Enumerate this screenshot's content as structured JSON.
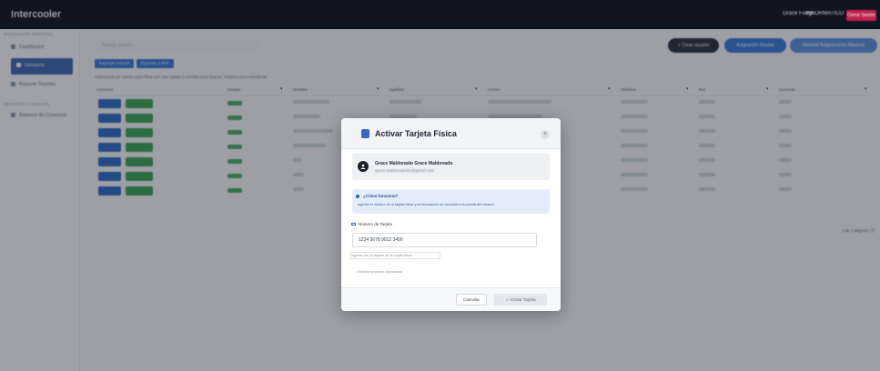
{
  "app": {
    "brand": "Intercooler",
    "top_user": "Grace Fuego",
    "top_role": "INFORMATICO",
    "logout_label": "Cerrar Sesión"
  },
  "sidebar": {
    "section_main": "NAVEGACIÓN PRINCIPAL",
    "section_reports": "REPORTES Y ANÁLISIS",
    "items": [
      {
        "label": "Dashboard"
      },
      {
        "label": "Usuarios"
      },
      {
        "label": "Reporte Tarjetas"
      },
      {
        "label": "Balance de Consumo"
      }
    ]
  },
  "main": {
    "search_placeholder": "Buscar usuario...",
    "actions": {
      "create_user": "+ Crear usuario",
      "mass_assign": "Asignación Masiva",
      "batch_history": "Historial Asignaciones Masivas"
    },
    "export_excel": "Exportar a Excel",
    "export_pdf": "Exportar a PDF",
    "hint": "Selecciona un campo para filtrar por ese campo y escribe para buscar. Arrastra para reordenar.",
    "columns": [
      "Acciones",
      "Estado",
      "Nombre",
      "Apellido",
      "Correo",
      "Teléfono",
      "Rol",
      "Sucursal"
    ],
    "pager": "1 de 1 páginas (7)"
  },
  "modal": {
    "title": "Activar Tarjeta Física",
    "close": "×",
    "user_name": "Grace Maldonado Grace Maldonado",
    "user_email": "grace.maldonado91@gmail.com",
    "info_title": "¿Cómo funciona?",
    "info_text": "Ingresa el número de la tarjeta física y la información se vinculará a la cuenta del usuario.",
    "field_label": "Número de Tarjeta",
    "card_value": "1234 5678 9012 3456",
    "helper": "Ingresa los 16 dígitos de la tarjeta física",
    "check_label": "Mostrar opciones avanzadas",
    "cancel": "Cancelar",
    "activate": "Activar Tarjeta"
  },
  "colors": {
    "topbar": "#0f1621",
    "primary": "#1f5fbf",
    "success": "#2e9a4a",
    "danger": "#c0214e"
  }
}
